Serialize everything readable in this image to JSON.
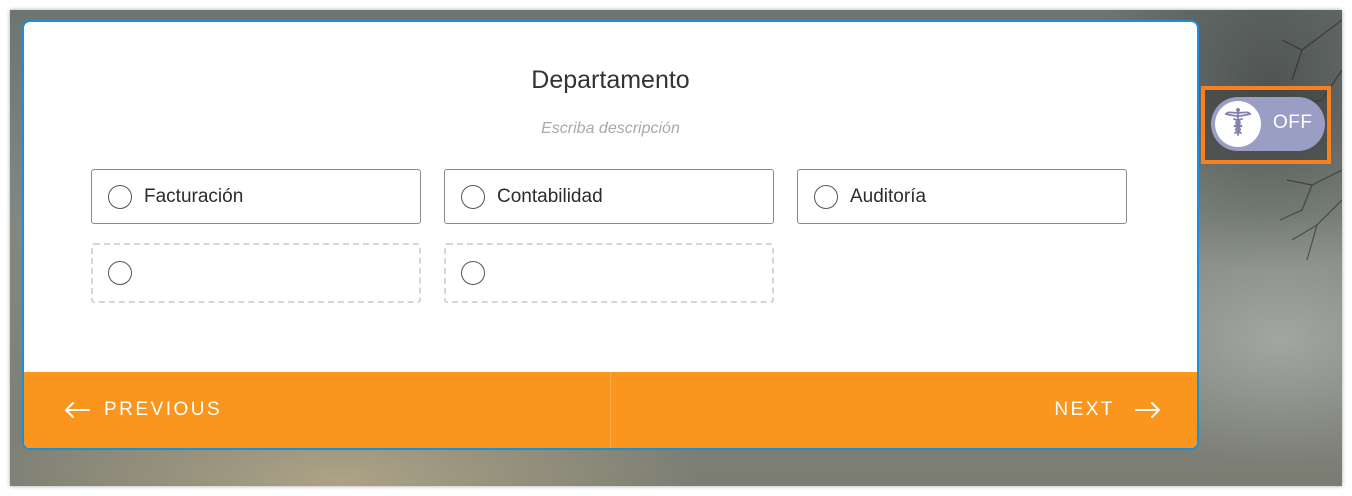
{
  "form": {
    "title": "Departamento",
    "description_placeholder": "Escriba descripción",
    "options": [
      {
        "label": "Facturación"
      },
      {
        "label": "Contabilidad"
      },
      {
        "label": "Auditoría"
      },
      {
        "label": ""
      },
      {
        "label": ""
      }
    ]
  },
  "footer": {
    "previous_label": "PREVIOUS",
    "next_label": "NEXT"
  },
  "toggle": {
    "state_label": "OFF",
    "icon": "caduceus-icon"
  },
  "colors": {
    "accent": "#fa961e",
    "card_border": "#1b8fd8",
    "toggle_bg": "#9a9ec5",
    "highlight": "#f7801f"
  }
}
